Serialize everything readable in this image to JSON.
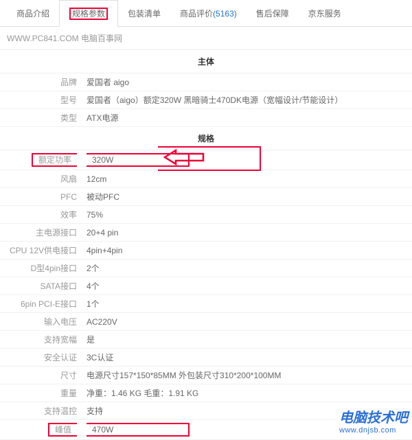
{
  "tabs": {
    "items": [
      {
        "label": "商品介绍"
      },
      {
        "label": "规格参数"
      },
      {
        "label": "包装清单"
      },
      {
        "label": "商品评价",
        "count": "(5163)"
      },
      {
        "label": "售后保障"
      },
      {
        "label": "京东服务"
      }
    ],
    "active_index": 1
  },
  "source_line": "WWW.PC841.COM 电脑百事网",
  "sections": {
    "body_header": "主体",
    "spec_header": "规格"
  },
  "body_rows": [
    {
      "k": "品牌",
      "v": "爱国者 aigo"
    },
    {
      "k": "型号",
      "v": "爱国者（aigo）额定320W 黑暗骑士470DK电源（宽幅设计/节能设计）"
    },
    {
      "k": "类型",
      "v": "ATX电源"
    }
  ],
  "spec_rows": [
    {
      "k": "额定功率",
      "v": "320W",
      "highlight": true,
      "arrow": true
    },
    {
      "k": "风扇",
      "v": "12cm"
    },
    {
      "k": "PFC",
      "v": "被动PFC"
    },
    {
      "k": "效率",
      "v": "75%"
    },
    {
      "k": "主电源接口",
      "v": "20+4 pin"
    },
    {
      "k": "CPU 12V供电接口",
      "v": "4pin+4pin"
    },
    {
      "k": "D型4pin接口",
      "v": "2个"
    },
    {
      "k": "SATA接口",
      "v": "4个"
    },
    {
      "k": "6pin PCI-E接口",
      "v": "1个"
    },
    {
      "k": "输入电压",
      "v": "AC220V"
    },
    {
      "k": "支持宽幅",
      "v": "是"
    },
    {
      "k": "安全认证",
      "v": "3C认证"
    },
    {
      "k": "尺寸",
      "v": "电源尺寸157*150*85MM 外包装尺寸310*200*100MM"
    },
    {
      "k": "重量",
      "v": "净重：1.46 KG 毛重：1.91 KG"
    },
    {
      "k": "支持温控",
      "v": "支持"
    },
    {
      "k": "峰值",
      "v": "470W",
      "highlight": true
    }
  ],
  "watermark": {
    "line1": "电脑技术吧",
    "line2": "www.dnjsb.com"
  }
}
